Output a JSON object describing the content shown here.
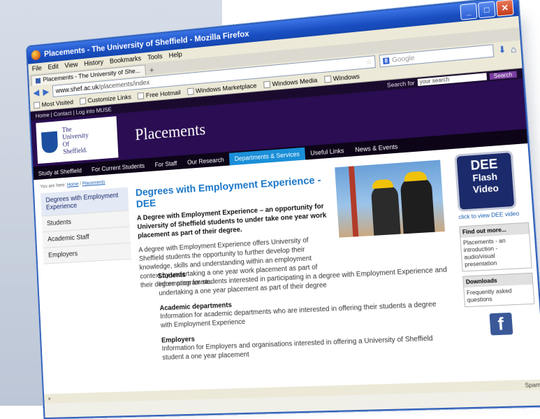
{
  "window": {
    "title": "Placements - The University of Sheffield - Mozilla Firefox"
  },
  "menu": [
    "File",
    "Edit",
    "View",
    "History",
    "Bookmarks",
    "Tools",
    "Help"
  ],
  "tab": {
    "label": "Placements - The University of She...",
    "new_tab": "+"
  },
  "nav": {
    "url_host": "www.shef.ac.uk",
    "url_path": "/placements/index",
    "search_placeholder": "Google"
  },
  "bookmarks": [
    "Most Visited",
    "Customize Links",
    "Free Hotmail",
    "Windows Marketplace",
    "Windows Media",
    "Windows"
  ],
  "site": {
    "top_links": "Home  |  Contact  |  Log into MUSE",
    "search_label": "Search for",
    "search_value": "your search",
    "search_button": "Search",
    "logo_lines": [
      "The",
      "University",
      "Of",
      "Sheffield."
    ],
    "title": "Placements",
    "main_nav": [
      "Study at Sheffield",
      "For Current Students",
      "For Staff",
      "Our Research",
      "Departments & Services",
      "Useful Links",
      "News & Events"
    ],
    "breadcrumb_prefix": "You are here:",
    "breadcrumb_home": "Home",
    "breadcrumb_current": "Placements",
    "side_nav": [
      "Degrees with Employment Experience",
      "Students",
      "Academic Staff",
      "Employers"
    ],
    "heading": "Degrees with Employment Experience - DEE",
    "intro": "A Degree with Employment Experience – an opportunity for University of Sheffield students to under take one year work placement as part of their degree.",
    "paragraph": "A degree with Employment Experience offers University of Sheffield students the opportunity to further develop their knowledge, skills and understanding within an employment context by undertaking a one year work placement as part of their degree programme.",
    "items": [
      {
        "title": "Students",
        "text": "Information for students interested in participating in a degree with Employment Experience and undertaking a one year placement as part of their degree"
      },
      {
        "title": "Academic departments",
        "text": "Information for academic departments who are interested in offering their students a degree with Employment Experience"
      },
      {
        "title": "Employers",
        "text": "Information for Employers and organisations interested in offering a University of Sheffield student a one year placement"
      }
    ],
    "dee_box": {
      "line1": "DEE",
      "line2": "Flash",
      "line3": "Video",
      "link": "click to view DEE video"
    },
    "find_out": {
      "title": "Find out more...",
      "text": "Placements - an introduction - audio/visual presentation"
    },
    "downloads": {
      "title": "Downloads",
      "text": "Frequently asked questions"
    },
    "facebook": "f"
  },
  "status": {
    "left": "×",
    "right": "Spam"
  }
}
